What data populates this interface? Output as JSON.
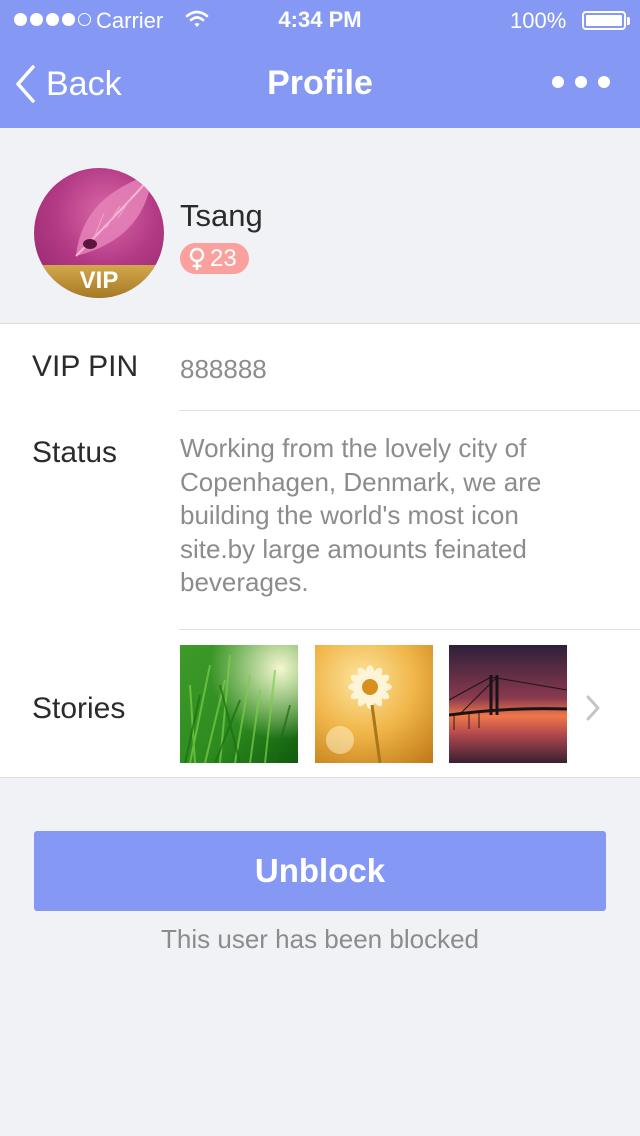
{
  "status_bar": {
    "carrier": "Carrier",
    "time": "4:34 PM",
    "battery": "100%",
    "signal_icon": "signal-dots-icon",
    "wifi_icon": "wifi-icon",
    "battery_icon": "battery-icon"
  },
  "nav": {
    "back_label": "Back",
    "title": "Profile",
    "more_icon": "more-dots-icon"
  },
  "profile": {
    "name": "Tsang",
    "vip_label": "VIP",
    "gender_icon": "female-icon",
    "age": "23"
  },
  "details": {
    "vip_pin_label": "VIP PIN",
    "vip_pin_value": "888888",
    "status_label": "Status",
    "status_value": "Working from the lovely city of Copenhagen, Denmark, we are building the world's most icon site.by large amounts feinated beverages.",
    "stories_label": "Stories",
    "stories": [
      "grass-photo",
      "flower-photo",
      "bridge-sunset-photo"
    ]
  },
  "actions": {
    "unblock_label": "Unblock",
    "blocked_note": "This user has been blocked"
  },
  "colors": {
    "accent": "#8599f4",
    "badge": "#fba19d",
    "vip_gold": "#c29a3e",
    "background": "#f1f2f6"
  }
}
